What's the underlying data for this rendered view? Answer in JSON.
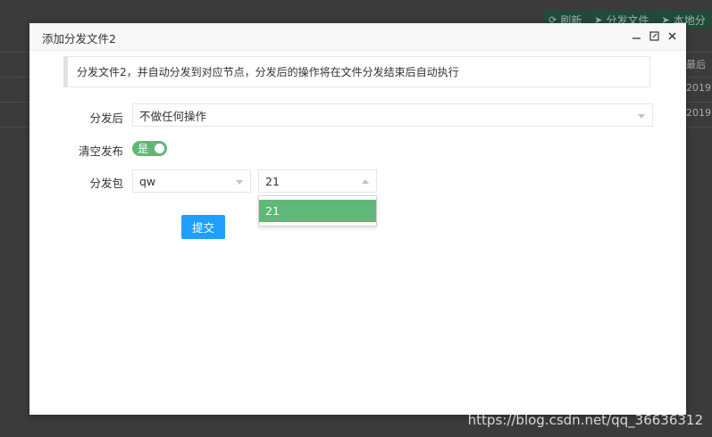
{
  "background": {
    "toolbar": [
      {
        "icon": "refresh-icon",
        "label": "刷新"
      },
      {
        "icon": "send-icon",
        "label": "分发文件"
      },
      {
        "icon": "send-icon",
        "label": "本地分"
      }
    ],
    "column_header": "最后",
    "cells": [
      "2019",
      "2019"
    ]
  },
  "modal": {
    "title": "添加分发文件2",
    "notice": "分发文件2，并自动分发到对应节点，分发后的操作将在文件分发结束后自动执行",
    "after_dispatch": {
      "label": "分发后",
      "value": "不做任何操作"
    },
    "clear_publish": {
      "label": "清空发布",
      "toggle_text": "是",
      "checked": true
    },
    "package": {
      "label": "分发包",
      "first_value": "qw",
      "second_value": "21",
      "options": [
        "21"
      ],
      "selected_option": "21"
    },
    "submit_label": "提交"
  },
  "watermark": "https://blog.csdn.net/qq_36636312",
  "colors": {
    "accent_green": "#5fb878",
    "primary_blue": "#1e9fff"
  }
}
